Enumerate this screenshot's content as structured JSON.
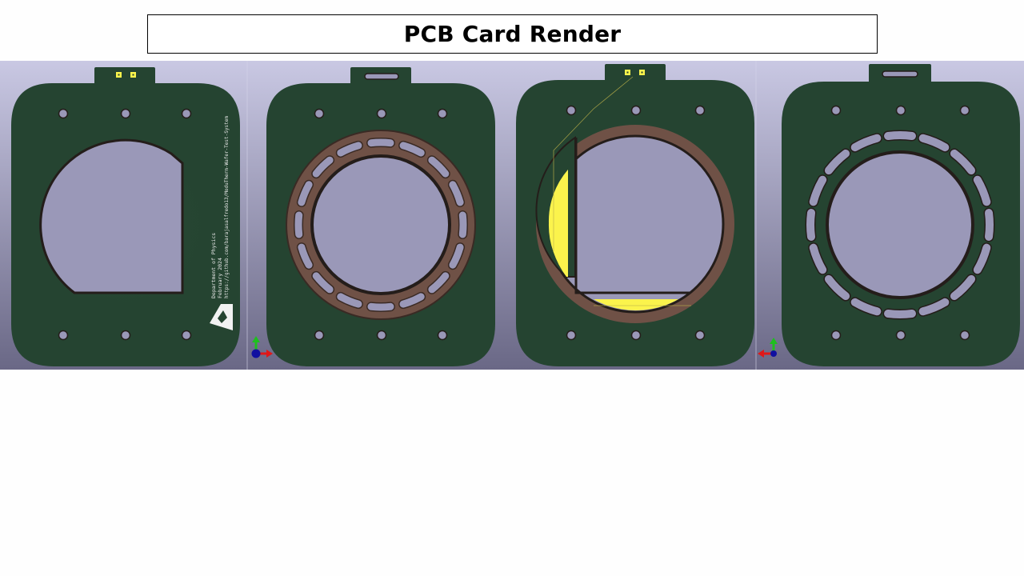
{
  "title": "PCB Card Render",
  "silkscreen": {
    "line1": "Department of Physics",
    "line2": "February 2024",
    "line3": "https://github.com/barajasalfredo13/ModuTherm-Wafer-Test-System"
  },
  "colors": {
    "pcb": "#254431",
    "pcb_shadow": "#241d1a",
    "copper_ring": "#6f5146",
    "pad_yellow": "#fbf34c",
    "hole": "#9a98b8",
    "bg_top": "#c9c8e3",
    "bg_bottom": "#6a6886",
    "outline": "#bdb24a"
  },
  "views": [
    {
      "name": "front-silkscreen"
    },
    {
      "name": "back-copper-ring"
    },
    {
      "name": "front-copper-pads"
    },
    {
      "name": "back-slots"
    }
  ]
}
